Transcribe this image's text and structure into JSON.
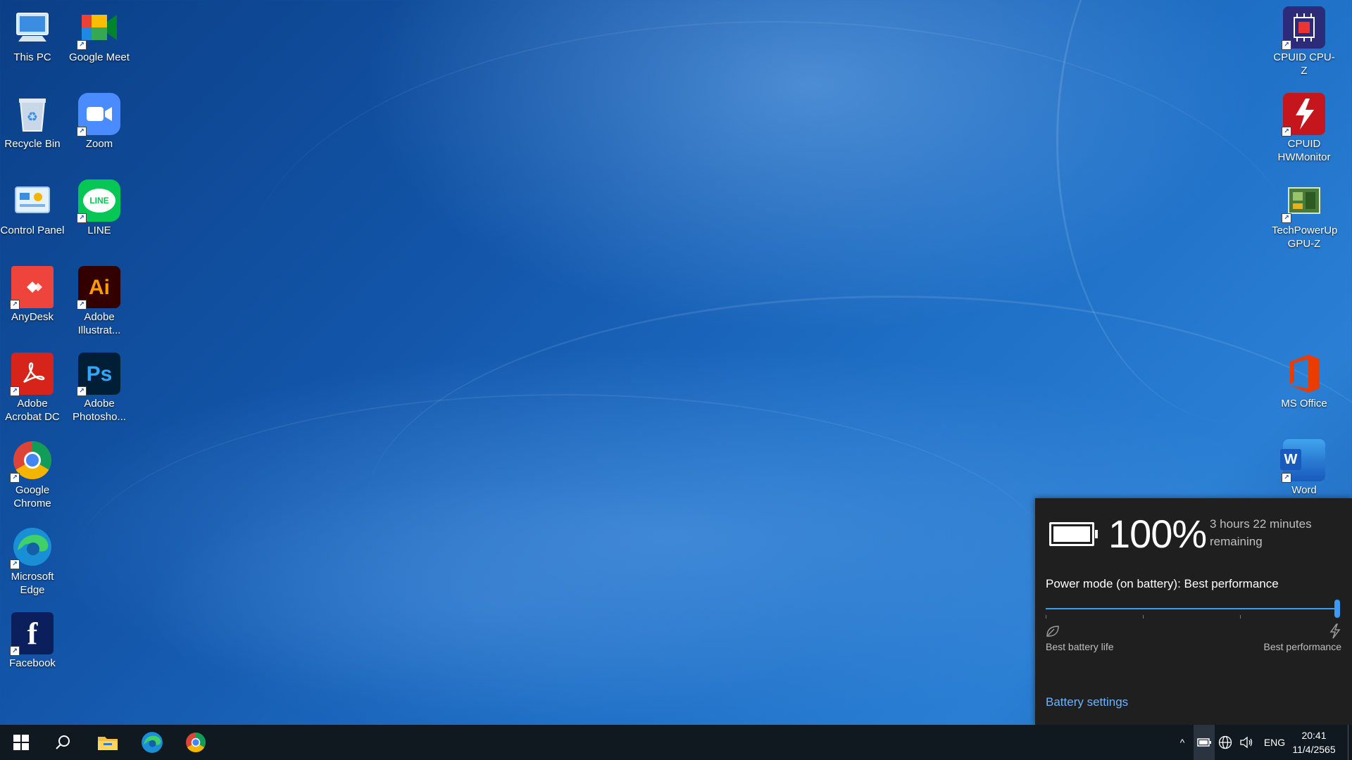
{
  "desktop": {
    "left_column_1": [
      {
        "label": "This PC",
        "icon": "this-pc-icon"
      },
      {
        "label": "Recycle Bin",
        "icon": "recycle-bin-icon"
      },
      {
        "label": "Control Panel",
        "icon": "control-panel-icon"
      },
      {
        "label": "AnyDesk",
        "icon": "anydesk-icon"
      },
      {
        "label": "Adobe Acrobat DC",
        "icon": "acrobat-icon"
      },
      {
        "label": "Google Chrome",
        "icon": "chrome-icon"
      },
      {
        "label": "Microsoft Edge",
        "icon": "edge-icon"
      },
      {
        "label": "Facebook",
        "icon": "facebook-icon"
      }
    ],
    "left_column_2": [
      {
        "label": "Google Meet",
        "icon": "google-meet-icon"
      },
      {
        "label": "Zoom",
        "icon": "zoom-icon"
      },
      {
        "label": "LINE",
        "icon": "line-icon"
      },
      {
        "label": "Adobe Illustrat...",
        "icon": "illustrator-icon"
      },
      {
        "label": "Adobe Photosho...",
        "icon": "photoshop-icon"
      }
    ],
    "right_column": [
      {
        "label": "CPUID CPU-Z",
        "icon": "cpuz-icon"
      },
      {
        "label": "CPUID HWMonitor",
        "icon": "hwmonitor-icon"
      },
      {
        "label": "TechPowerUp GPU-Z",
        "icon": "gpuz-icon"
      },
      {
        "label": "MS Office",
        "icon": "office-icon"
      },
      {
        "label": "Word",
        "icon": "word-icon"
      }
    ],
    "icon_text": {
      "illustrator": "Ai",
      "photoshop": "Ps",
      "word": "W",
      "facebook": "f",
      "line": "LINE"
    }
  },
  "battery_flyout": {
    "percent": "100%",
    "charge_level": 1.0,
    "remaining": "3 hours 22 minutes remaining",
    "power_mode": "Power mode (on battery): Best performance",
    "slider_value": 1.0,
    "left_label": "Best battery life",
    "right_label": "Best performance",
    "settings_link": "Battery settings"
  },
  "taskbar": {
    "pinned": [
      "windows-start-icon",
      "search-icon",
      "file-explorer-icon",
      "edge-icon",
      "chrome-icon"
    ],
    "tray": {
      "chevron": "^",
      "language": "ENG",
      "time": "20:41",
      "date": "11/4/2565"
    }
  },
  "colors": {
    "accent": "#3a9bf0",
    "link": "#6cb4ff",
    "flyout_bg": "#1f1f1f",
    "taskbar_bg": "#101820"
  }
}
